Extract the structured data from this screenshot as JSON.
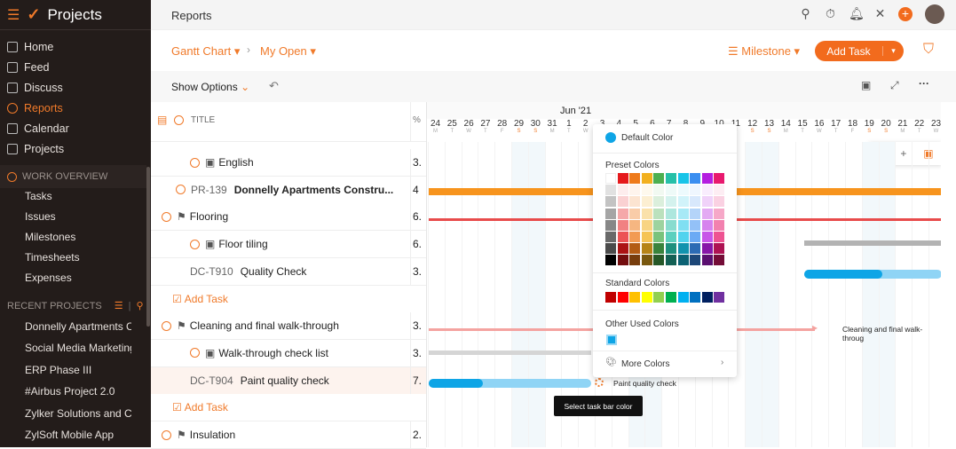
{
  "app": {
    "name": "Projects"
  },
  "sidebar": {
    "items": [
      {
        "label": "Home"
      },
      {
        "label": "Feed"
      },
      {
        "label": "Discuss"
      },
      {
        "label": "Reports"
      },
      {
        "label": "Calendar"
      },
      {
        "label": "Projects"
      }
    ],
    "work_overview": {
      "title": "WORK OVERVIEW",
      "items": [
        "Tasks",
        "Issues",
        "Milestones",
        "Timesheets",
        "Expenses"
      ]
    },
    "recent": {
      "title": "RECENT PROJECTS",
      "items": [
        "Donnelly Apartments C",
        "Social Media Marketing",
        "ERP Phase III",
        "#Airbus Project 2.0",
        "Zylker Solutions and Co",
        "ZylSoft Mobile App"
      ]
    }
  },
  "topbar": {
    "title": "Reports"
  },
  "breadcrumb": {
    "view": "Gantt Chart",
    "filter": "My Open",
    "group": "Milestone",
    "add_task": "Add Task"
  },
  "options": {
    "show_options": "Show Options"
  },
  "grid": {
    "title_header": "TITLE",
    "pct_header": "%",
    "rows": [
      {
        "code": "",
        "title": "English",
        "pct": "3.",
        "icon": "task-list",
        "indent": 2
      },
      {
        "code": "PR-139",
        "title": "Donnelly Apartments Constru...",
        "pct": "4",
        "icon": "",
        "indent": 0,
        "bold": true
      },
      {
        "code": "",
        "title": "Flooring",
        "pct": "6.",
        "icon": "milestone",
        "indent": 1
      },
      {
        "code": "",
        "title": "Floor tiling",
        "pct": "6.",
        "icon": "task-list",
        "indent": 2
      },
      {
        "code": "DC-T910",
        "title": "Quality Check",
        "pct": "3.",
        "icon": "",
        "indent": 3
      },
      {
        "code": "",
        "title": "Add Task",
        "pct": "",
        "icon": "add",
        "indent": 1
      },
      {
        "code": "",
        "title": "Cleaning and final walk-through",
        "pct": "3.",
        "icon": "milestone",
        "indent": 1
      },
      {
        "code": "",
        "title": "Walk-through check list",
        "pct": "3.",
        "icon": "task-list",
        "indent": 2
      },
      {
        "code": "DC-T904",
        "title": "Paint quality check",
        "pct": "7.",
        "icon": "",
        "indent": 3
      },
      {
        "code": "",
        "title": "Add Task",
        "pct": "",
        "icon": "add",
        "indent": 1
      },
      {
        "code": "",
        "title": "Insulation",
        "pct": "2.",
        "icon": "milestone",
        "indent": 1
      }
    ]
  },
  "gantt": {
    "month": "Jun '21",
    "days": [
      [
        "24",
        "M"
      ],
      [
        "25",
        "T"
      ],
      [
        "26",
        "W"
      ],
      [
        "27",
        "T"
      ],
      [
        "28",
        "F"
      ],
      [
        "29",
        "S"
      ],
      [
        "30",
        "S"
      ],
      [
        "31",
        "M"
      ],
      [
        "1",
        "T"
      ],
      [
        "2",
        "W"
      ],
      [
        "3",
        "T"
      ],
      [
        "4",
        "F"
      ],
      [
        "5",
        "S"
      ],
      [
        "6",
        "S"
      ],
      [
        "7",
        "M"
      ],
      [
        "8",
        "T"
      ],
      [
        "9",
        "W"
      ],
      [
        "10",
        "T"
      ],
      [
        "11",
        "F"
      ],
      [
        "12",
        "S"
      ],
      [
        "13",
        "S"
      ],
      [
        "14",
        "M"
      ],
      [
        "15",
        "T"
      ],
      [
        "16",
        "W"
      ],
      [
        "17",
        "T"
      ],
      [
        "18",
        "F"
      ],
      [
        "19",
        "S"
      ],
      [
        "20",
        "S"
      ],
      [
        "21",
        "M"
      ],
      [
        "22",
        "T"
      ],
      [
        "23",
        "W"
      ]
    ],
    "bar_labels": {
      "cleaning": "Cleaning and final walk-throug",
      "paint": "Paint quality check"
    },
    "colors": {
      "milestone": "#f7941d",
      "flooring": "#e84b4b",
      "progress": "#0ea5e6",
      "progress_light": "#8fd4f5",
      "tasklist": "#b3b3b3",
      "cleaning": "#f4a3a0"
    }
  },
  "color_picker": {
    "default_label": "Default Color",
    "default_color": "#0ea5e6",
    "preset_label": "Preset Colors",
    "preset_base": [
      "#ffffff",
      "#e5191c",
      "#ee7a1a",
      "#f2b01e",
      "#4caf50",
      "#26c0a8",
      "#18c4e8",
      "#3a8ef0",
      "#b41ee0",
      "#e8196e"
    ],
    "standard_label": "Standard Colors",
    "standard": [
      "#c00000",
      "#ff0000",
      "#ffc000",
      "#ffff00",
      "#92d050",
      "#00b050",
      "#00b0f0",
      "#0070c0",
      "#002060",
      "#7030a0"
    ],
    "other_label": "Other Used Colors",
    "other": [
      "#0ea5e6"
    ],
    "more_label": "More Colors"
  },
  "tooltip": "Select task bar color"
}
